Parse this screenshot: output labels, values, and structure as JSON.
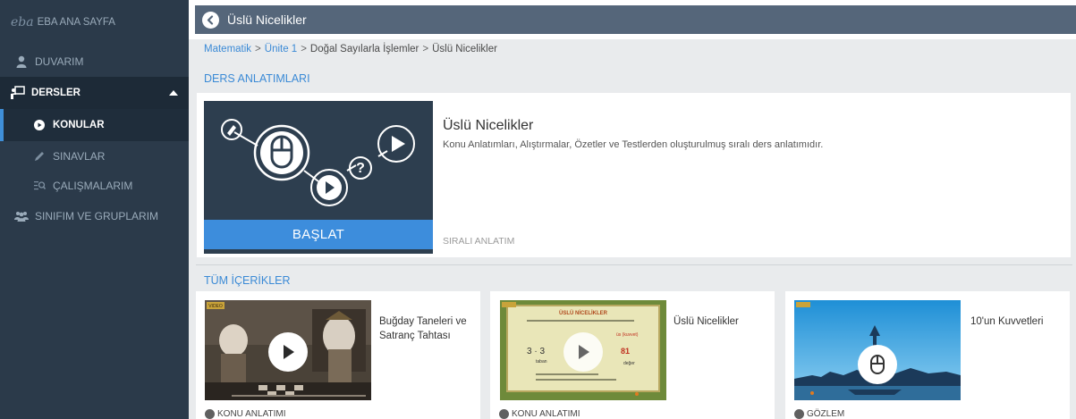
{
  "sidebar": {
    "logo_text": "eba",
    "items": [
      {
        "label": "EBA ANA SAYFA"
      },
      {
        "label": "DUVARIM"
      },
      {
        "label": "DERSLER"
      },
      {
        "label": "KONULAR"
      },
      {
        "label": "SINAVLAR"
      },
      {
        "label": "ÇALIŞMALARIM"
      },
      {
        "label": "SINIFIM VE GRUPLARIM"
      }
    ]
  },
  "header": {
    "title": "Üslü Nicelikler"
  },
  "breadcrumb": {
    "items": [
      "Matematik",
      "Ünite 1",
      "Doğal Sayılarla İşlemler",
      "Üslü Nicelikler"
    ],
    "separator": ">"
  },
  "lessons_section": {
    "heading": "DERS ANLATIMLARI",
    "course": {
      "title": "Üslü Nicelikler",
      "description": "Konu Anlatımları, Alıştırmalar, Özetler ve Testlerden oluşturulmuş sıralı ders anlatımıdır.",
      "type": "SIRALI ANLATIM",
      "start_label": "BAŞLAT"
    }
  },
  "contents_section": {
    "heading": "TÜM İÇERİKLER",
    "cards": [
      {
        "title": "Buğday Taneleri ve Satranç Tahtası",
        "type": "KONU ANLATIMI",
        "badge": "VIDEO"
      },
      {
        "title": "Üslü Nicelikler",
        "type": "KONU ANLATIMI",
        "board_title": "ÜSLÜ NİCELİKLER",
        "board_expr": "3 · 3",
        "board_exp_label": "üs (kuvvet)",
        "board_value_label": "değer",
        "board_base": "taban"
      },
      {
        "title": "10'un Kuvvetleri",
        "type": "GÖZLEM"
      }
    ]
  },
  "colors": {
    "sidebar_bg": "#2b3a4a",
    "accent": "#3b8ad6",
    "header_bg": "#55667a",
    "start_button": "#3d8ddc"
  }
}
